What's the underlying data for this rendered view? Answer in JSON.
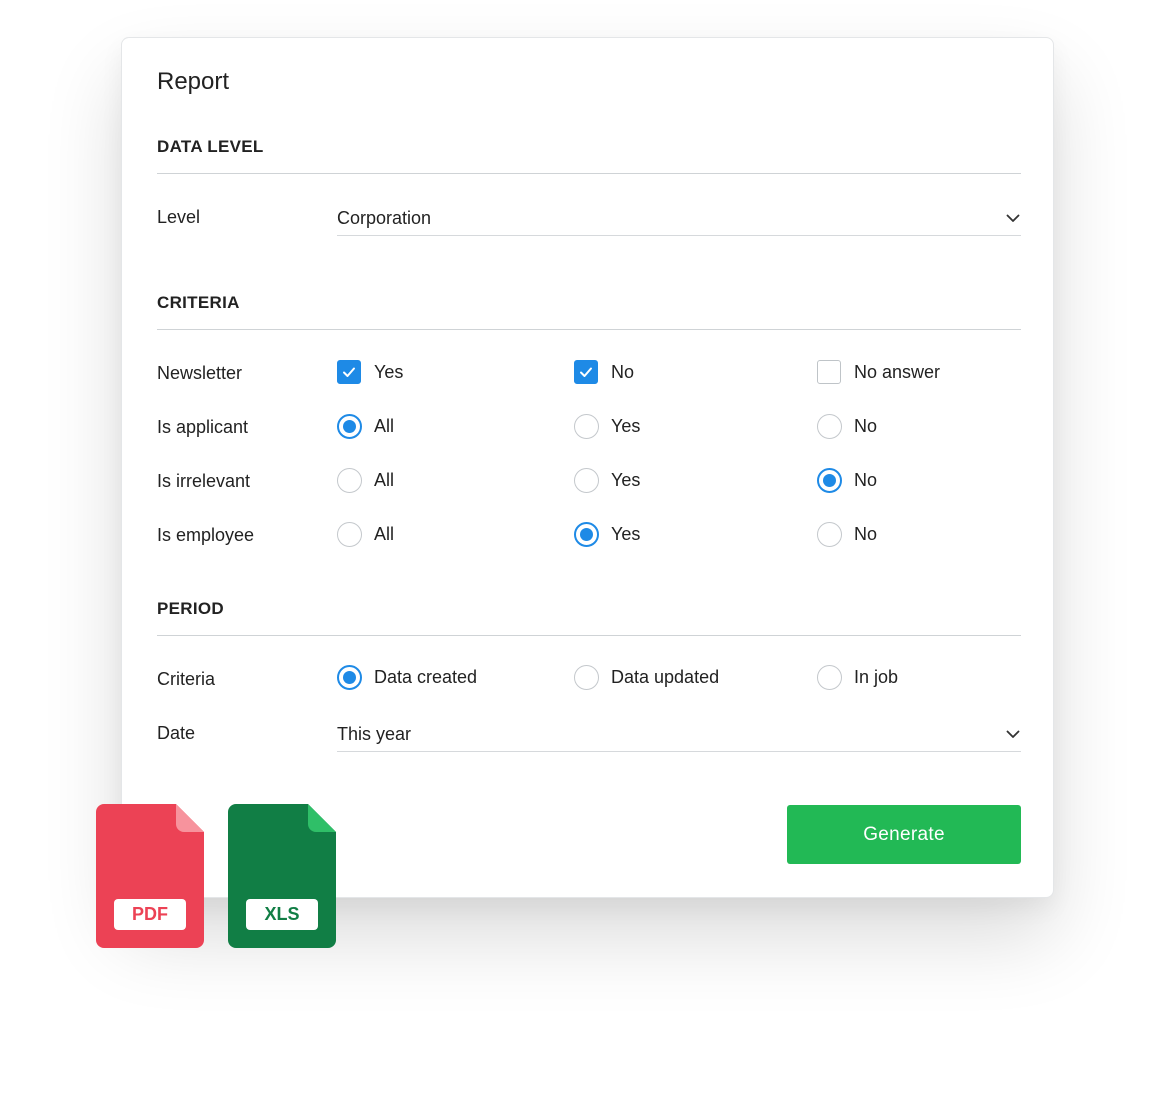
{
  "title": "Report",
  "data_level": {
    "heading": "DATA LEVEL",
    "level_label": "Level",
    "level_value": "Corporation"
  },
  "criteria": {
    "heading": "CRITERIA",
    "rows": [
      {
        "label": "Newsletter",
        "type": "checkbox",
        "options": [
          {
            "label": "Yes",
            "checked": true
          },
          {
            "label": "No",
            "checked": true
          },
          {
            "label": "No answer",
            "checked": false
          }
        ]
      },
      {
        "label": "Is applicant",
        "type": "radio",
        "options": [
          {
            "label": "All",
            "checked": true
          },
          {
            "label": "Yes",
            "checked": false
          },
          {
            "label": "No",
            "checked": false
          }
        ]
      },
      {
        "label": "Is irrelevant",
        "type": "radio",
        "options": [
          {
            "label": "All",
            "checked": false
          },
          {
            "label": "Yes",
            "checked": false
          },
          {
            "label": "No",
            "checked": true
          }
        ]
      },
      {
        "label": "Is employee",
        "type": "radio",
        "options": [
          {
            "label": "All",
            "checked": false
          },
          {
            "label": "Yes",
            "checked": true
          },
          {
            "label": "No",
            "checked": false
          }
        ]
      }
    ]
  },
  "period": {
    "heading": "PERIOD",
    "criteria_label": "Criteria",
    "criteria_options": [
      {
        "label": "Data created",
        "checked": true
      },
      {
        "label": "Data updated",
        "checked": false
      },
      {
        "label": "In job",
        "checked": false
      }
    ],
    "date_label": "Date",
    "date_value": "This year"
  },
  "generate_label": "Generate",
  "files": {
    "pdf_label": "PDF",
    "xls_label": "XLS"
  },
  "colors": {
    "accent": "#1e8ae6",
    "generate": "#22b955",
    "pdf": "#ec4255",
    "xls": "#117e45"
  }
}
